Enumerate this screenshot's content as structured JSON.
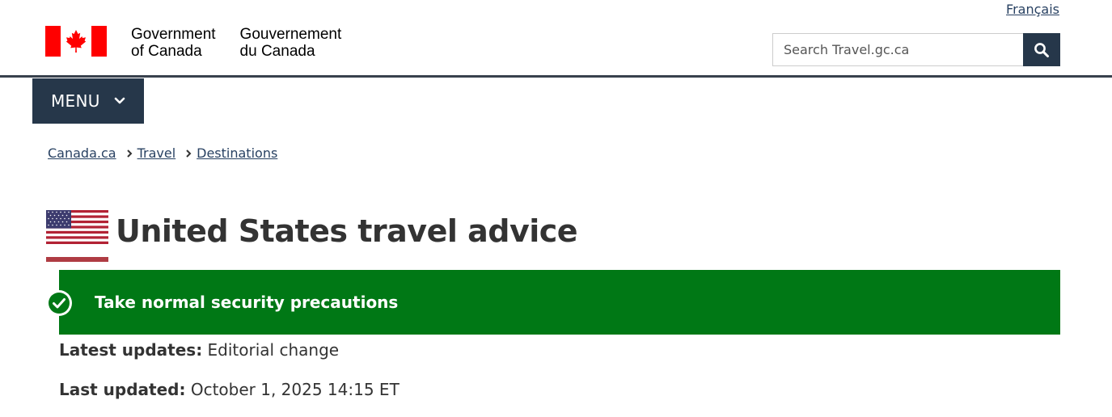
{
  "header": {
    "language_link": "Français",
    "signature_en_line1": "Government",
    "signature_en_line2": "of Canada",
    "signature_fr_line1": "Gouvernement",
    "signature_fr_line2": "du Canada",
    "search_placeholder": "Search Travel.gc.ca",
    "search_icon": "magnifier-icon"
  },
  "menu": {
    "label": "MENU",
    "icon": "chevron-down-icon"
  },
  "breadcrumb": [
    {
      "label": "Canada.ca"
    },
    {
      "label": "Travel"
    },
    {
      "label": "Destinations"
    }
  ],
  "page": {
    "title": "United States travel advice",
    "flag": "us-flag"
  },
  "advisory": {
    "level_text": "Take normal security precautions",
    "icon": "check-circle-icon",
    "color": "#007815"
  },
  "meta": {
    "latest_updates_label": "Latest updates:",
    "latest_updates_value": "Editorial change",
    "last_updated_label": "Last updated:",
    "last_updated_value": "October 1, 2025 14:15 ET"
  },
  "colors": {
    "navy": "#26374a",
    "link": "#284162",
    "flag_red": "#ff0000",
    "accent_red": "#af3c43"
  }
}
